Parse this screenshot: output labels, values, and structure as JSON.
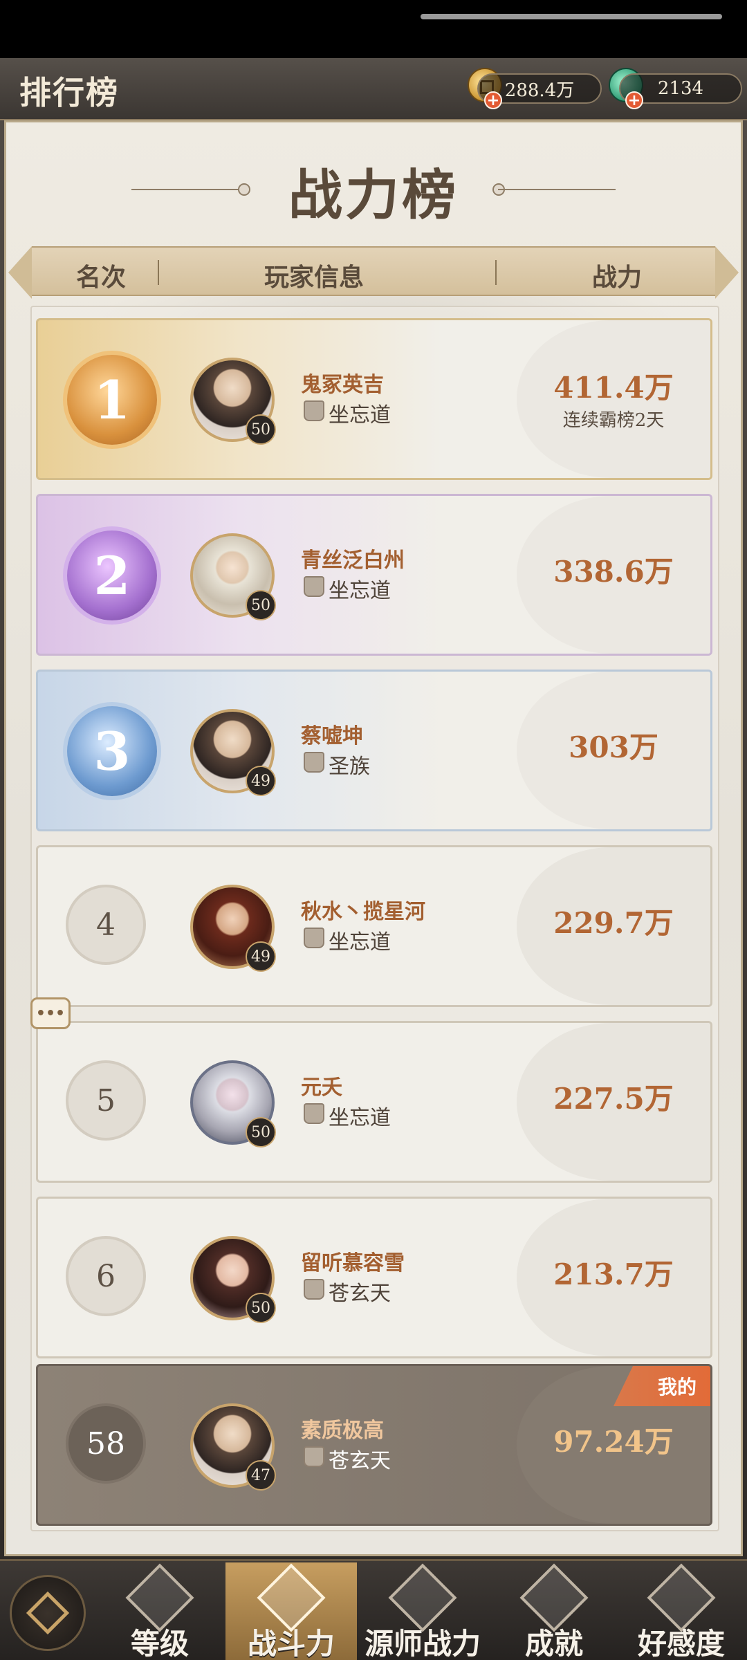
{
  "header": {
    "title": "排行榜",
    "currencies": [
      {
        "icon": "coin-icon",
        "value": "288.4万"
      },
      {
        "icon": "jade-icon",
        "value": "2134"
      }
    ]
  },
  "board": {
    "title": "战力榜",
    "columns": [
      "名次",
      "玩家信息",
      "战力"
    ]
  },
  "rows": [
    {
      "rank": "1",
      "name": "鬼冢英吉",
      "level": "50",
      "guild": "坐忘道",
      "power": "411.4万",
      "note": "连续霸榜2天"
    },
    {
      "rank": "2",
      "name": "青丝泛白州",
      "level": "50",
      "guild": "坐忘道",
      "power": "338.6万"
    },
    {
      "rank": "3",
      "name": "蔡嘘坤",
      "level": "49",
      "guild": "圣族",
      "power": "303万"
    },
    {
      "rank": "4",
      "name": "秋水丶揽星河",
      "level": "49",
      "guild": "坐忘道",
      "power": "229.7万"
    },
    {
      "rank": "5",
      "name": "元夭",
      "level": "50",
      "guild": "坐忘道",
      "power": "227.5万"
    },
    {
      "rank": "6",
      "name": "留听慕容雪",
      "level": "50",
      "guild": "苍玄天",
      "power": "213.7万"
    },
    {
      "rank": "58",
      "name": "素质极高",
      "level": "47",
      "guild": "苍玄天",
      "power": "97.24万",
      "tag": "我的"
    }
  ],
  "chat": {
    "label": "•••"
  },
  "nav": {
    "tabs": [
      "等级",
      "战斗力",
      "源师战力",
      "成就",
      "好感度"
    ],
    "active": "战斗力"
  },
  "colors": {
    "accent": "#b26634",
    "nav_active": "#c79e60",
    "me_tag": "#e26b38"
  }
}
